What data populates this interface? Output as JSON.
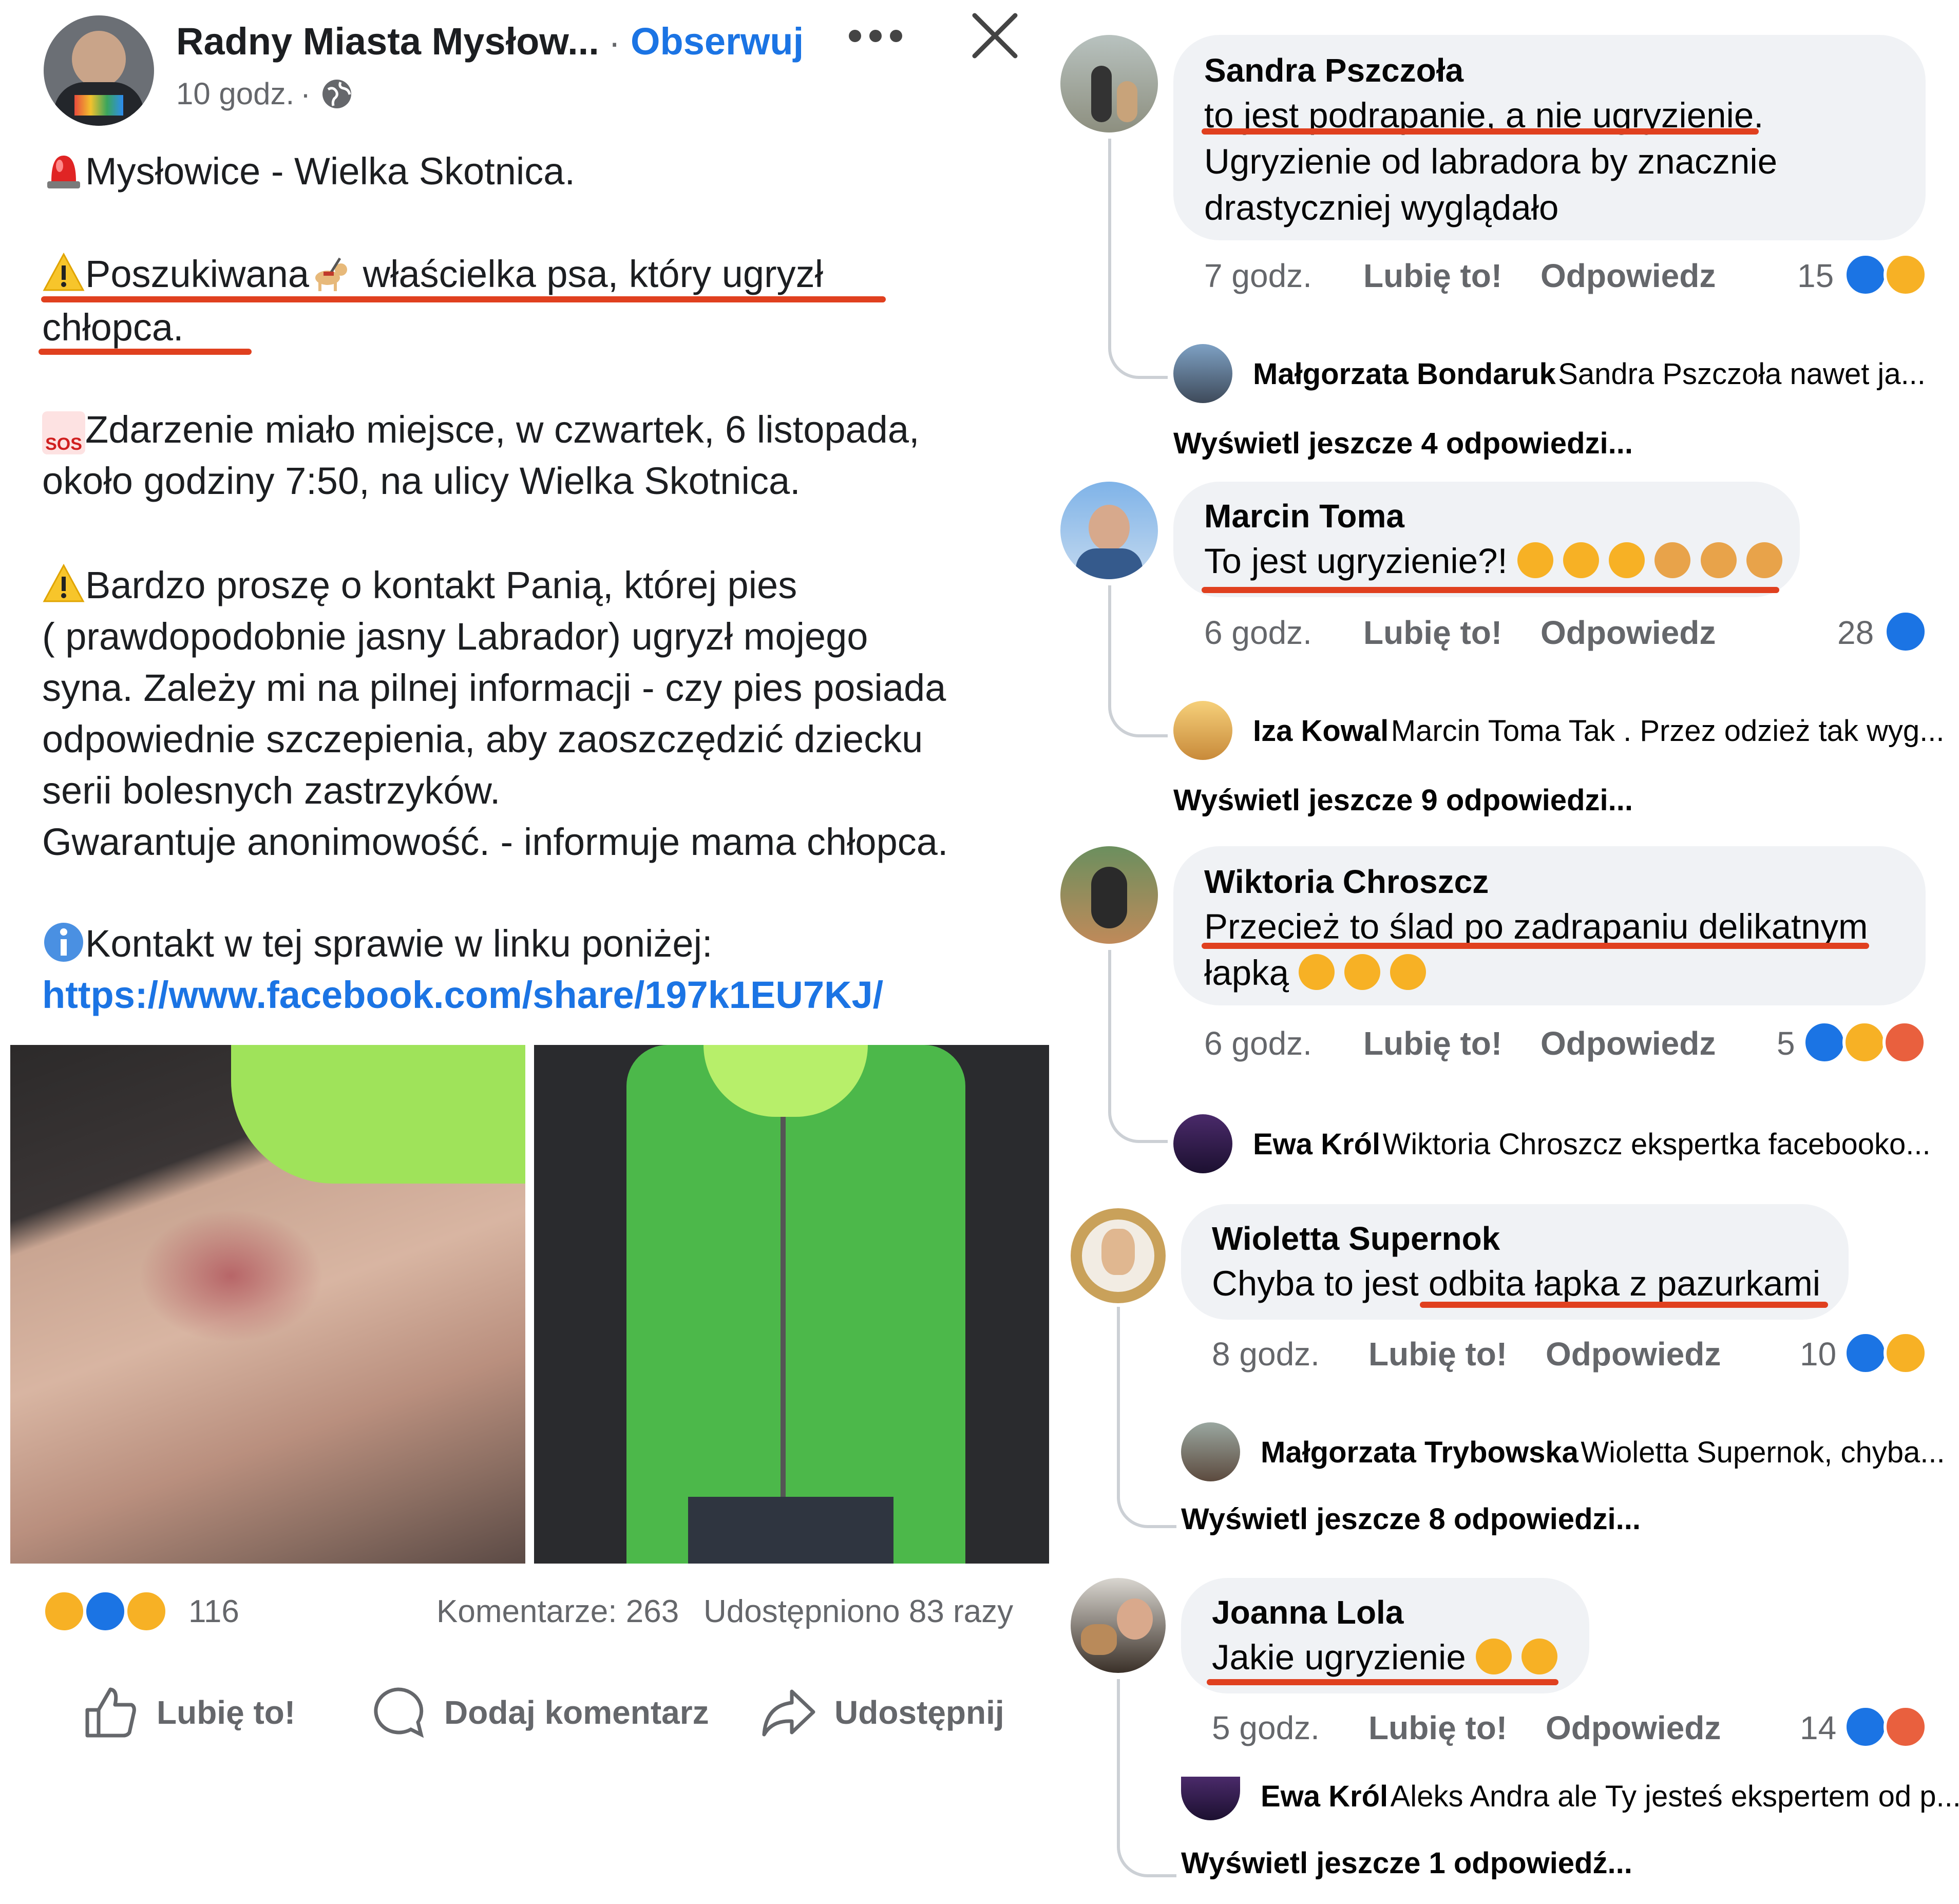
{
  "post": {
    "author": "Radny Miasta Mysłow...",
    "separator": "·",
    "follow_label": "Obserwuj",
    "time": "10 godz.",
    "time_sep": "·",
    "line1": "Mysłowice - Wielka Skotnica.",
    "line2a": "Poszukiwana",
    "line2b": " właścielka psa, który ugryzł",
    "line3": "chłopca.",
    "para2_l1": "Zdarzenie miało miejsce, w czwartek, 6 listopada,",
    "para2_l2": "około godziny 7:50, na ulicy Wielka Skotnica.",
    "para3_l1": "Bardzo proszę o kontakt Panią, której pies",
    "para3_l2": "( prawdopodobnie jasny Labrador) ugryzł mojego",
    "para3_l3": "syna. Zależy mi na pilnej informacji - czy pies posiada",
    "para3_l4": "odpowiednie szczepienia, aby zaoszczędzić dziecku",
    "para3_l5": "serii bolesnych zastrzyków.",
    "para3_l6": "Gwarantuje anonimowość. - informuje mama chłopca.",
    "para4_l1": "Kontakt w tej sprawie w linku poniżej:",
    "link": "https://www.facebook.com/share/197k1EU7KJ/",
    "sos_label": "SOS",
    "reactions_count": "116",
    "comments_count": "Komentarze: 263",
    "shares_count": "Udostępniono 83 razy",
    "actions": {
      "like": "Lubię to!",
      "comment": "Dodaj komentarz",
      "share": "Udostępnij"
    },
    "icons": [
      "siren-icon",
      "warning-icon",
      "guide-dog-icon",
      "sos-icon",
      "info-icon",
      "globe-icon",
      "more-icon",
      "close-icon"
    ],
    "colors": {
      "link": "#1b74e4",
      "underline": "#e0401f",
      "jacket": "#4cb84a"
    }
  },
  "comments": [
    {
      "name": "Sandra Pszczoła",
      "text_l1": "to jest podrapanie, a nie ugryzienie.",
      "text_l2": "Ugryzienie od labradora by znacznie",
      "text_l3": "drastyczniej wyglądało",
      "time": "7 godz.",
      "like": "Lubię to!",
      "reply": "Odpowiedz",
      "count": "15",
      "reply_preview_name": "Małgorzata Bondaruk",
      "reply_preview_text": "Sandra Pszczoła nawet ja...",
      "more_replies": "Wyświetl jeszcze 4 odpowiedzi..."
    },
    {
      "name": "Marcin Toma",
      "text_l1": "To jest ugryzienie?!",
      "time": "6 godz.",
      "like": "Lubię to!",
      "reply": "Odpowiedz",
      "count": "28",
      "reply_preview_name": "Iza Kowal",
      "reply_preview_text": "Marcin Toma Tak . Przez odzież tak wyg...",
      "more_replies": "Wyświetl jeszcze 9 odpowiedzi..."
    },
    {
      "name": "Wiktoria Chroszcz",
      "text_l1": "Przecież to ślad po zadrapaniu delikatnym",
      "text_l2": "łapką",
      "time": "6 godz.",
      "like": "Lubię to!",
      "reply": "Odpowiedz",
      "count": "5",
      "reply_preview_name": "Ewa Król",
      "reply_preview_text": "Wiktoria Chroszcz ekspertka facebooko..."
    },
    {
      "name": "Wioletta Supernok",
      "text_l1": "Chyba to jest odbita łapka z pazurkami",
      "time": "8 godz.",
      "like": "Lubię to!",
      "reply": "Odpowiedz",
      "count": "10",
      "reply_preview_name": "Małgorzata Trybowska",
      "reply_preview_text": "Wioletta Supernok, chyba...",
      "more_replies": "Wyświetl jeszcze 8 odpowiedzi..."
    },
    {
      "name": "Joanna Lola",
      "text_l1": "Jakie ugryzienie",
      "time": "5 godz.",
      "like": "Lubię to!",
      "reply": "Odpowiedz",
      "count": "14",
      "reply_preview_name": "Ewa Król",
      "reply_preview_text": "Aleks Andra ale Ty jesteś ekspertem od p...",
      "more_replies": "Wyświetl jeszcze 1 odpowiedź..."
    }
  ]
}
